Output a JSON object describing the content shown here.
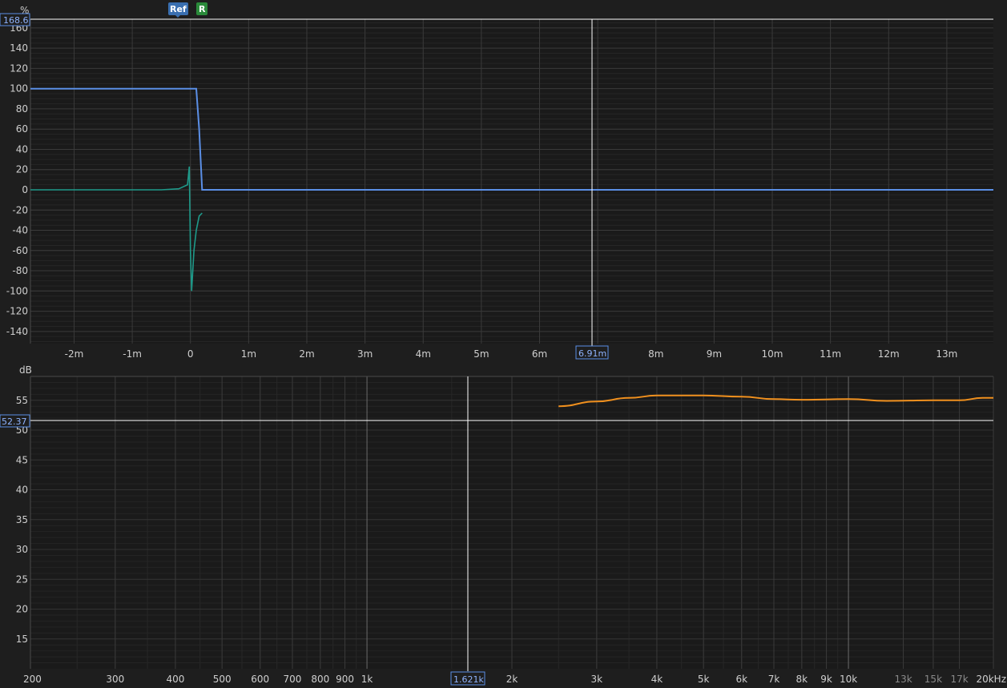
{
  "markers": {
    "ref_label": "Ref",
    "r_label": "R"
  },
  "top_graph": {
    "y_unit": "%",
    "y_max_readout": "168.6",
    "cursor_x_label": "6.91m",
    "y_ticks": [
      "160",
      "140",
      "120",
      "100",
      "80",
      "60",
      "40",
      "20",
      "0",
      "-20",
      "-40",
      "-60",
      "-80",
      "-100",
      "-120",
      "-140"
    ],
    "x_ticks": [
      "-2m",
      "-1m",
      "0",
      "1m",
      "2m",
      "3m",
      "4m",
      "5m",
      "6m",
      "7m",
      "8m",
      "9m",
      "10m",
      "11m",
      "12m",
      "13m"
    ],
    "colors": {
      "step_response": "#5b8fe6",
      "impulse_response": "#1e9a8a"
    }
  },
  "bottom_graph": {
    "y_unit": "dB",
    "cursor_y_label": "52.37",
    "cursor_x_label": "1.621k",
    "y_ticks": [
      "55",
      "50",
      "45",
      "40",
      "35",
      "30",
      "25",
      "20",
      "15"
    ],
    "x_ticks": [
      "200",
      "300",
      "400",
      "500",
      "600",
      "700",
      "800",
      "900",
      "1k",
      "2k",
      "3k",
      "4k",
      "5k",
      "6k",
      "7k",
      "8k",
      "9k",
      "10k",
      "13k",
      "15k",
      "17k",
      "20kHz"
    ],
    "colors": {
      "spl_trace": "#f0901e"
    }
  },
  "chart_data": [
    {
      "type": "line",
      "title": "",
      "xlabel": "",
      "ylabel": "%",
      "xlim": [
        -2.75,
        13.8
      ],
      "ylim": [
        -152,
        168.6
      ],
      "series": [
        {
          "x": [
            -2.75,
            0.1,
            0.15,
            0.2,
            13.8
          ],
          "values": [
            100,
            100,
            60,
            0,
            0
          ]
        },
        {
          "x": [
            -2.75,
            -0.5,
            -0.2,
            -0.05,
            -0.02,
            0.0,
            0.02,
            0.06,
            0.1,
            0.15,
            0.2
          ],
          "values": [
            0,
            0,
            1,
            5,
            23,
            -60,
            -100,
            -60,
            -40,
            -26,
            -23
          ]
        }
      ]
    },
    {
      "type": "line",
      "title": "",
      "xlabel": "",
      "ylabel": "dB",
      "xscale": "log",
      "xlim": [
        200,
        20000
      ],
      "ylim": [
        10,
        59
      ],
      "series": [
        {
          "x": [
            2500,
            3000,
            3500,
            4000,
            5000,
            6000,
            7000,
            8000,
            10000,
            12000,
            15000,
            17000,
            19000,
            20000
          ],
          "values": [
            54.0,
            54.8,
            55.4,
            55.8,
            55.8,
            55.6,
            55.2,
            55.1,
            55.2,
            54.9,
            55.0,
            55.0,
            55.4,
            55.4
          ]
        }
      ]
    }
  ]
}
